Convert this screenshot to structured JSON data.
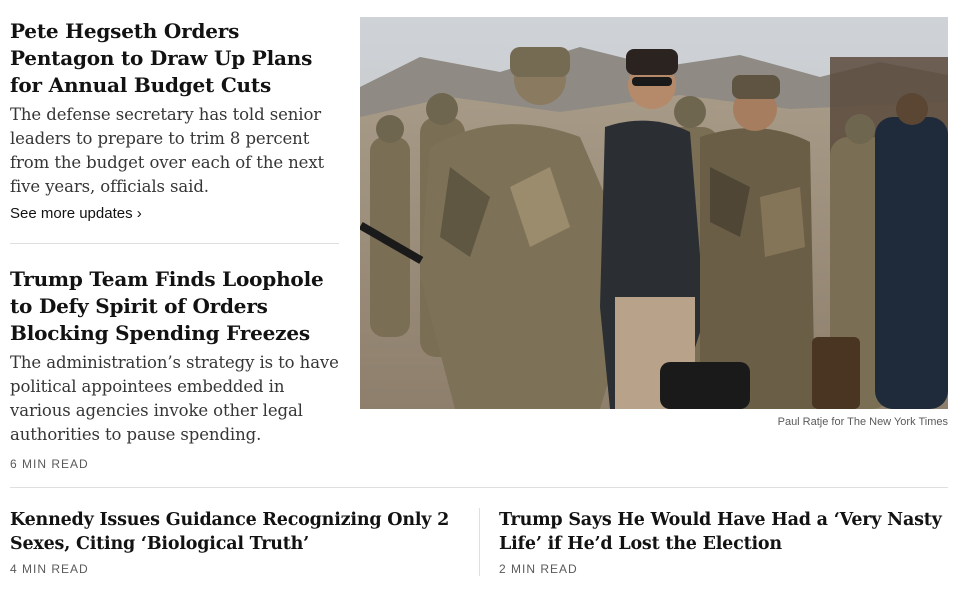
{
  "stories": {
    "lead": {
      "headline": "Pete Hegseth Orders Pentagon to Draw Up Plans for Annual Budget Cuts",
      "summary": "The defense secretary has told senior leaders to prepare to trim 8 percent from the budget over each of the next five years, officials said.",
      "more_link": "See more updates ›"
    },
    "second": {
      "headline": "Trump Team Finds Loophole to Defy Spirit of Orders Blocking Spending Freezes",
      "summary": "The administration’s strategy is to have political appointees embedded in various agencies invoke other legal authorities to pause spending.",
      "read_time": "6 MIN READ"
    },
    "third": {
      "headline": "Kennedy Issues Guidance Recognizing Only 2 Sexes, Citing ‘Biological Truth’",
      "read_time": "4 MIN READ"
    },
    "fourth": {
      "headline": "Trump Says He Would Have Had a ‘Very Nasty Life’ if He’d Lost the Election",
      "read_time": "2 MIN READ"
    }
  },
  "photo": {
    "credit": "Paul Ratje for The New York Times"
  },
  "colors": {
    "text": "#121212",
    "summary": "#363636",
    "meta": "#5a5a5a",
    "divider": "#dfdfdf"
  }
}
